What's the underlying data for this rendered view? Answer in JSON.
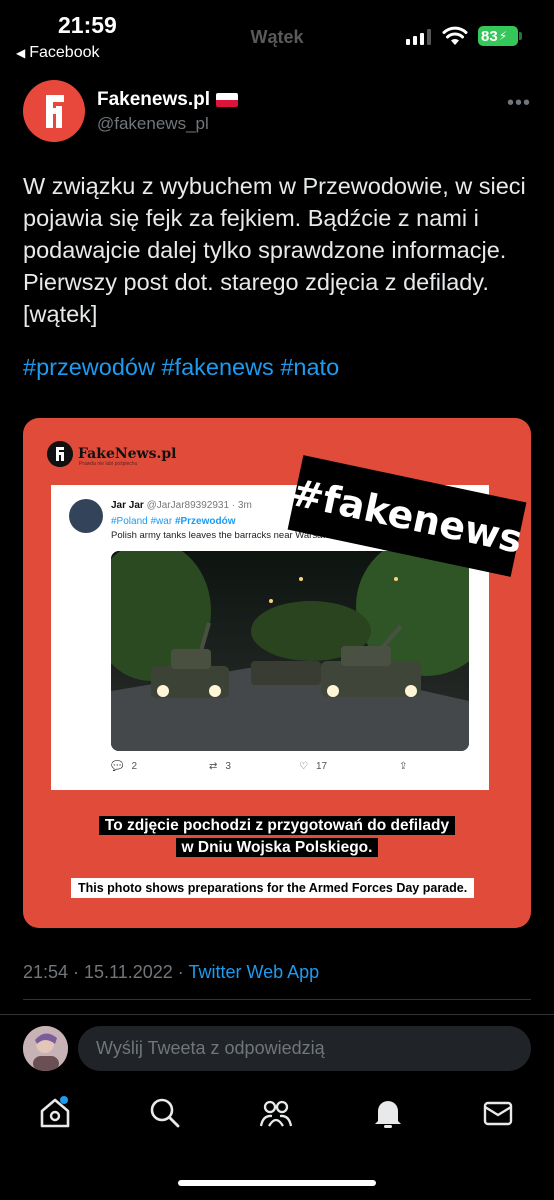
{
  "status_bar": {
    "time": "21:59",
    "back_label": "Facebook",
    "title": "Wątek",
    "battery": "83"
  },
  "tweet": {
    "display_name": "Fakenews.pl",
    "handle": "@fakenews_pl",
    "text": "W związku z wybuchem w Przewodowie, w sieci pojawia się fejk za fejkiem. Bądźcie z nami i podawajcie dalej tylko sprawdzone informacje. Pierwszy post dot. starego zdjęcia z defilady. [wątek]",
    "hashtags": "#przewodów #fakenews #nato",
    "timestamp": "21:54 · 15.11.2022 · ",
    "source_app": "Twitter Web App"
  },
  "media": {
    "brand": "FakeNews.pl",
    "brand_sub": "Prawda nie lubi pośpiechu",
    "banner": "#fakenews",
    "inner_tweet": {
      "name": "Jar Jar",
      "handle_time": "@JarJar89392931 · 3m",
      "hashtags_prefix": "#Poland #war ",
      "hashtag_bold": "#Przewodów",
      "text": "Polish army tanks  leaves the barracks near Warsaw",
      "replies": "2",
      "retweets": "3",
      "likes": "17"
    },
    "caption_pl_line1": "To zdjęcie pochodzi z przygotowań do defilady",
    "caption_pl_line2": "w Dniu Wojska Polskiego.",
    "caption_en": "This photo shows preparations for the Armed Forces Day parade."
  },
  "reply": {
    "placeholder": "Wyślij Tweeta z odpowiedzią"
  },
  "tabbar": {
    "icons": [
      "home-icon",
      "search-icon",
      "communities-icon",
      "notifications-icon",
      "messages-icon"
    ]
  },
  "colors": {
    "accent": "#1d9bf0",
    "card_red": "#e04b3a",
    "battery_green": "#35c759"
  }
}
